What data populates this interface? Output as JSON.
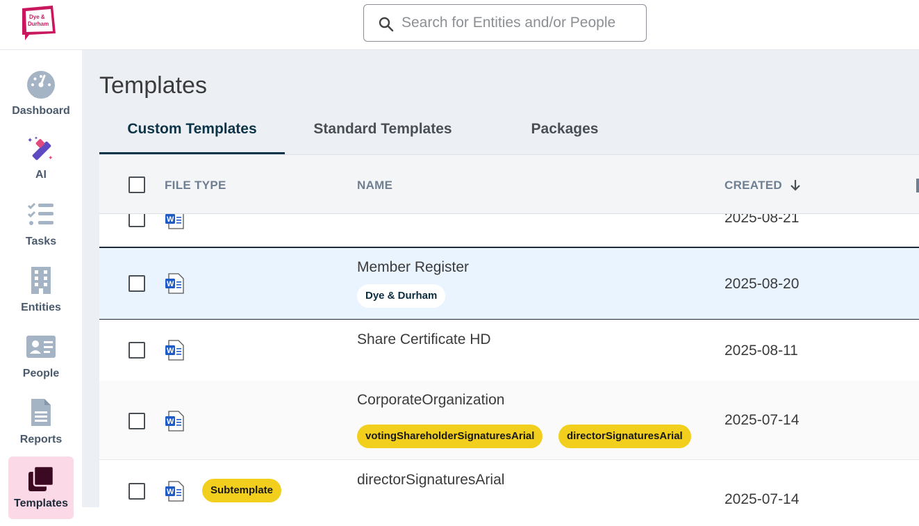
{
  "brand": {
    "logo_text_1": "Dye &",
    "logo_text_2": "Durham"
  },
  "search": {
    "placeholder": "Search for Entities and/or People"
  },
  "sidebar": {
    "items": [
      {
        "label": "Dashboard",
        "icon": "dashboard-icon"
      },
      {
        "label": "AI",
        "icon": "ai-wand-icon"
      },
      {
        "label": "Tasks",
        "icon": "tasks-icon"
      },
      {
        "label": "Entities",
        "icon": "building-icon"
      },
      {
        "label": "People",
        "icon": "id-card-icon"
      },
      {
        "label": "Reports",
        "icon": "report-icon"
      },
      {
        "label": "Templates",
        "icon": "templates-icon",
        "active": true
      }
    ]
  },
  "page": {
    "title": "Templates"
  },
  "tabs": [
    {
      "label": "Custom Templates",
      "active": true
    },
    {
      "label": "Standard Templates"
    },
    {
      "label": "Packages"
    }
  ],
  "table": {
    "headers": {
      "file_type": "FILE TYPE",
      "name": "NAME",
      "created": "CREATED"
    },
    "sort": {
      "column": "created",
      "direction": "descending",
      "icon": "arrow-down-icon"
    },
    "rows": [
      {
        "file_type": "word-doc-icon",
        "name": "",
        "created": "2025-08-21",
        "tags": []
      },
      {
        "file_type": "word-doc-icon",
        "name": "Member Register",
        "created": "2025-08-20",
        "tags": [
          "Dye & Durham"
        ]
      },
      {
        "file_type": "word-doc-icon",
        "name": "Share Certificate HD",
        "created": "2025-08-11",
        "tags": []
      },
      {
        "file_type": "word-doc-icon",
        "name": "CorporateOrganization",
        "created": "2025-07-14",
        "tags": [
          "votingShareholderSignaturesArial",
          "directorSignaturesArial"
        ]
      },
      {
        "file_type": "word-doc-icon",
        "name": "directorSignaturesArial",
        "created": "2025-07-14",
        "tags": [],
        "badge": "Subtemplate"
      }
    ]
  },
  "colors": {
    "accent": "#0c3347",
    "brand": "#c8175d",
    "highlight_row": "#eaf4ff",
    "chip_yellow": "#f2cf1d",
    "active_nav": "#fbd9e6"
  }
}
